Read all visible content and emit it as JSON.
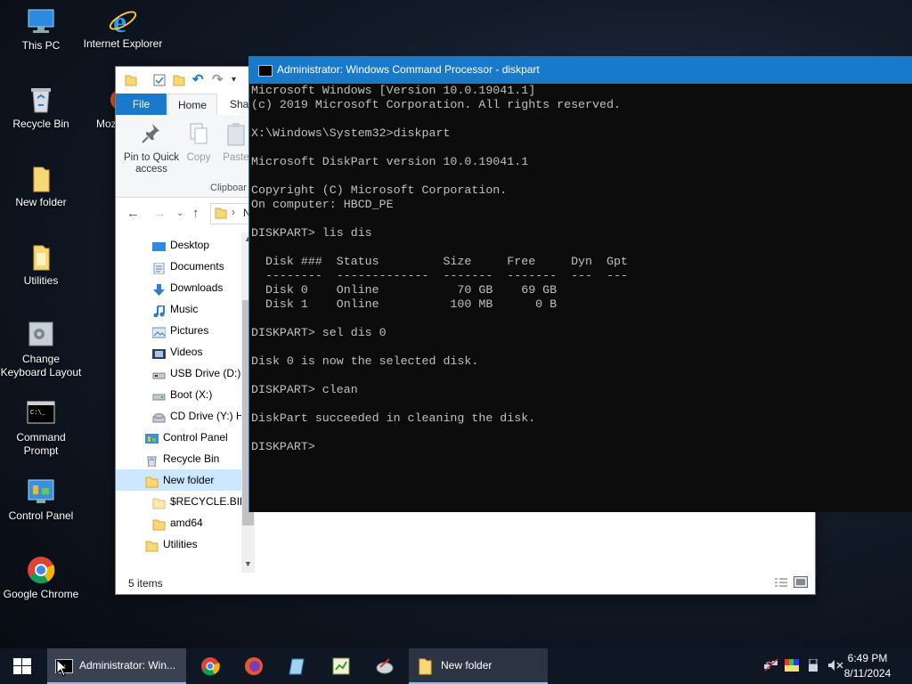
{
  "desktop": {
    "icons": [
      {
        "label": "This PC",
        "icon": "computer-icon"
      },
      {
        "label": "Internet Explorer",
        "icon": "internet-explorer-icon"
      },
      {
        "label": "Recycle Bin",
        "icon": "recycle-bin-icon"
      },
      {
        "label": "Mozil",
        "icon": "firefox-icon"
      },
      {
        "label": "New folder",
        "icon": "folder-icon"
      },
      {
        "label": "Utilities",
        "icon": "folder-icon"
      },
      {
        "label": "Change Keyboard Layout",
        "icon": "keyboard-settings-icon"
      },
      {
        "label": "Command Prompt",
        "icon": "command-prompt-icon"
      },
      {
        "label": "Control Panel",
        "icon": "control-panel-icon"
      },
      {
        "label": "Google Chrome",
        "icon": "chrome-icon"
      }
    ]
  },
  "explorer": {
    "tabs": {
      "file": "File",
      "home": "Home",
      "share": "Shai"
    },
    "ribbon": {
      "pin_label": "Pin to Quick access",
      "copy_label": "Copy",
      "paste_label": "Paste",
      "group_label": "Clipboar"
    },
    "address_fragment": "N",
    "nav_items": [
      {
        "label": "Desktop",
        "icon": "desktop-icon"
      },
      {
        "label": "Documents",
        "icon": "documents-icon"
      },
      {
        "label": "Downloads",
        "icon": "downloads-icon"
      },
      {
        "label": "Music",
        "icon": "music-icon"
      },
      {
        "label": "Pictures",
        "icon": "pictures-icon"
      },
      {
        "label": "Videos",
        "icon": "videos-icon"
      },
      {
        "label": "USB Drive (D:)",
        "icon": "usb-drive-icon"
      },
      {
        "label": "Boot (X:)",
        "icon": "drive-icon"
      },
      {
        "label": "CD Drive (Y:) H",
        "icon": "cd-drive-icon"
      },
      {
        "label": "Control Panel",
        "icon": "control-panel-icon"
      },
      {
        "label": "Recycle Bin",
        "icon": "recycle-bin-icon"
      },
      {
        "label": "New folder",
        "icon": "folder-icon",
        "selected": true
      },
      {
        "label": "$RECYCLE.BIN",
        "icon": "folder-icon"
      },
      {
        "label": "amd64",
        "icon": "folder-icon"
      },
      {
        "label": "Utilities",
        "icon": "folder-icon"
      }
    ],
    "status": "5 items"
  },
  "cmd": {
    "title": "Administrator: Windows Command Processor - diskpart",
    "output": "Microsoft Windows [Version 10.0.19041.1]\n(c) 2019 Microsoft Corporation. All rights reserved.\n\nX:\\Windows\\System32>diskpart\n\nMicrosoft DiskPart version 10.0.19041.1\n\nCopyright (C) Microsoft Corporation.\nOn computer: HBCD_PE\n\nDISKPART> lis dis\n\n  Disk ###  Status         Size     Free     Dyn  Gpt\n  --------  -------------  -------  -------  ---  ---\n  Disk 0    Online           70 GB    69 GB\n  Disk 1    Online          100 MB      0 B\n\nDISKPART> sel dis 0\n\nDisk 0 is now the selected disk.\n\nDISKPART> clean\n\nDiskPart succeeded in cleaning the disk.\n\nDISKPART> "
  },
  "taskbar": {
    "cmd_label": "Administrator: Win...",
    "folder_label": "New folder",
    "time": "6:49 PM",
    "date": "8/11/2024"
  },
  "colors": {
    "accent": "#1979ca",
    "cmd_bg": "#0c0c0c",
    "cmd_text": "#c0c0c0",
    "folder": "#f8d775",
    "taskbar": "#0f1724"
  }
}
